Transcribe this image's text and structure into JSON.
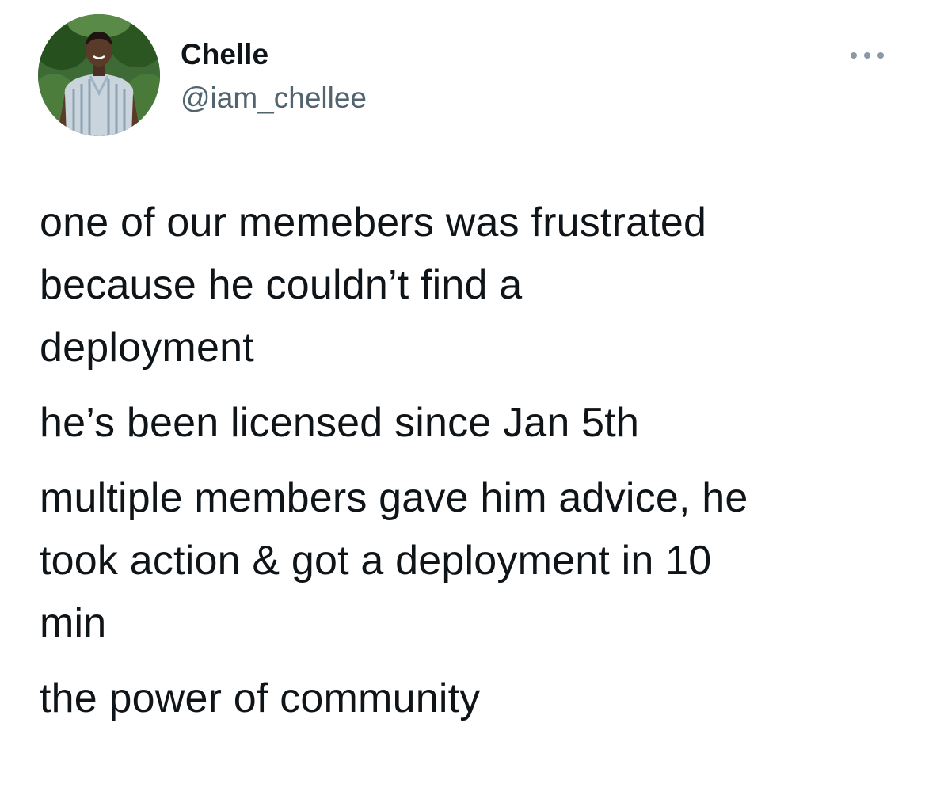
{
  "tweet": {
    "author": {
      "display_name": "Chelle",
      "handle": "@iam_chellee",
      "avatar_icon": "profile-photo"
    },
    "more_icon": "more-options-icon",
    "paragraphs": [
      {
        "lines": [
          "one of our memebers was frustrated",
          "because he couldn’t find a",
          "deployment"
        ]
      },
      {
        "lines": [
          "he’s been licensed since Jan 5th"
        ]
      },
      {
        "lines": [
          "multiple members gave him advice, he",
          "took action & got a deployment in 10",
          "min"
        ]
      },
      {
        "lines": [
          "the power of community"
        ]
      }
    ]
  },
  "colors": {
    "text_primary": "#0f1419",
    "text_secondary": "#536471",
    "background": "#ffffff",
    "icon_gray": "#8b98a5"
  }
}
